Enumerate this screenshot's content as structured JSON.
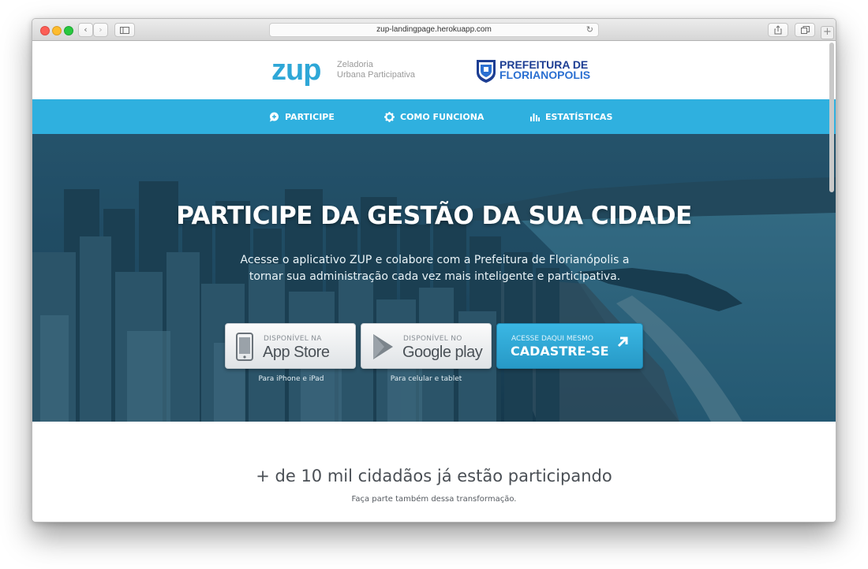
{
  "browser": {
    "url": "zup-landingpage.herokuapp.com",
    "back_glyph": "‹",
    "forward_glyph": "›",
    "reload_glyph": "↻",
    "new_tab_glyph": "+"
  },
  "header": {
    "logo_text": "zup",
    "tagline_line1": "Zeladoria",
    "tagline_line2": "Urbana Participativa",
    "partner_line1": "PREFEITURA DE",
    "partner_line2": "FLORIANOPOLIS"
  },
  "nav": {
    "items": [
      {
        "label": "PARTICIPE",
        "icon": "chat-bubble-icon"
      },
      {
        "label": "COMO FUNCIONA",
        "icon": "gear-icon"
      },
      {
        "label": "ESTATÍSTICAS",
        "icon": "bar-chart-icon"
      }
    ]
  },
  "hero": {
    "title": "PARTICIPE DA GESTÃO DA SUA CIDADE",
    "subtitle_line1": "Acesse o aplicativo ZUP e colabore com a Prefeitura de Florianópolis a",
    "subtitle_line2": "tornar sua administração cada vez mais inteligente e participativa.",
    "appstore": {
      "small": "DISPONÍVEL NA",
      "big": "App Store",
      "caption": "Para iPhone e iPad"
    },
    "googleplay": {
      "small": "DISPONÍVEL NO",
      "big": "Google play",
      "caption": "Para celular e tablet"
    },
    "signup": {
      "small": "ACESSE DAQUI MESMO",
      "big": "CADASTRE-SE"
    }
  },
  "stats": {
    "headline": "+ de 10 mil cidadãos já estão participando",
    "subline": "Faça parte também dessa transformação."
  },
  "colors": {
    "accent": "#2fb0df",
    "logo": "#2ea7d7",
    "partner": "#1d3e93"
  }
}
